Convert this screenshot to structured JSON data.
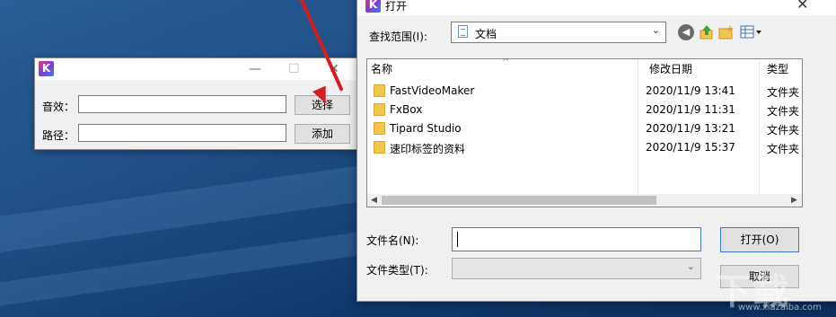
{
  "small_window": {
    "effect_label": "音效：",
    "effect_value": "",
    "path_label": "路径：",
    "path_value": "",
    "select_button": "选择",
    "add_button": "添加",
    "minimize_glyph": "—",
    "maximize_glyph": "☐",
    "close_glyph": "✕"
  },
  "open_dialog": {
    "title": "打开",
    "close_glyph": "✕",
    "lookin_label": "查找范围(I):",
    "lookin_value": "文档",
    "columns": {
      "name": "名称",
      "modified": "修改日期",
      "type": "类型"
    },
    "files": [
      {
        "name": "FastVideoMaker",
        "modified": "2020/11/9 13:41",
        "type": "文件夹"
      },
      {
        "name": "FxBox",
        "modified": "2020/11/9 11:31",
        "type": "文件夹"
      },
      {
        "name": "Tipard Studio",
        "modified": "2020/11/9 13:21",
        "type": "文件夹"
      },
      {
        "name": "速印标签的资料",
        "modified": "2020/11/9 15:37",
        "type": "文件夹"
      }
    ],
    "filename_label": "文件名(N):",
    "filename_value": "",
    "filetype_label": "文件类型(T):",
    "filetype_value": "",
    "open_button": "打开(O)",
    "cancel_button": "取消"
  },
  "app_logo_letter": "K",
  "watermark": {
    "big": "下载",
    "small": "www.xiazaiba.com"
  },
  "colors": {
    "desktop": "#1f4f86",
    "arrow": "#d51e1e",
    "focus_border": "#3b7bd6"
  }
}
